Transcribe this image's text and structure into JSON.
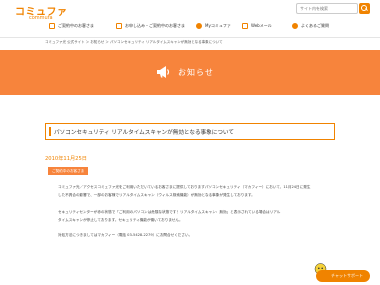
{
  "header": {
    "logo_main": "コミュファ",
    "logo_sub": "commufa",
    "search_placeholder": "サイト内を検索",
    "nav": [
      {
        "label": "ご契約中のお客さま"
      },
      {
        "label": "お申し込み・ご契約中のお客さま"
      },
      {
        "label": "Myコミュファ"
      },
      {
        "label": "Webメール"
      },
      {
        "label": "よくあるご質問"
      }
    ]
  },
  "breadcrumb": "コミュファ光 公式サイト ＞ お知らせ ＞ パソコンセキュリティ リアルタイムスキャンが無効となる事象について",
  "banner": {
    "title": "お知らせ",
    "icon": "megaphone-icon"
  },
  "article": {
    "title": "パソコンセキュリティ リアルタイムスキャンが無効となる事象について",
    "date": "2010年11月25日",
    "tag": "ご契約中のお客さま",
    "paragraphs": [
      "コミュファ光／アクセスコミュファ光をご利用いただいているお客さまに提供しておりますパソコンセキュリティ（マカフィー）において、11月24日に発生",
      "した不具合の影響で、一部のお客様でリアルタイムスキャン（ウィルス検索機能）が無効となる事象が発生しております。",
      "",
      "セキュリティセンターが赤の状態で「ご利用のパソコンは危険な状態です！リアルタイムスキャン：無効」と表示されている場合はリアル",
      "タイムスキャンが停止しております。セキュリティ機能が働いておりません。",
      "",
      "対処方法につきましてはマカフィー（電話 03-5428-2279）にお問合せください。"
    ]
  },
  "chat": {
    "label": "チャットサポート",
    "icon": "mascot-icon"
  },
  "colors": {
    "accent": "#f08300",
    "banner": "#f7843c"
  }
}
